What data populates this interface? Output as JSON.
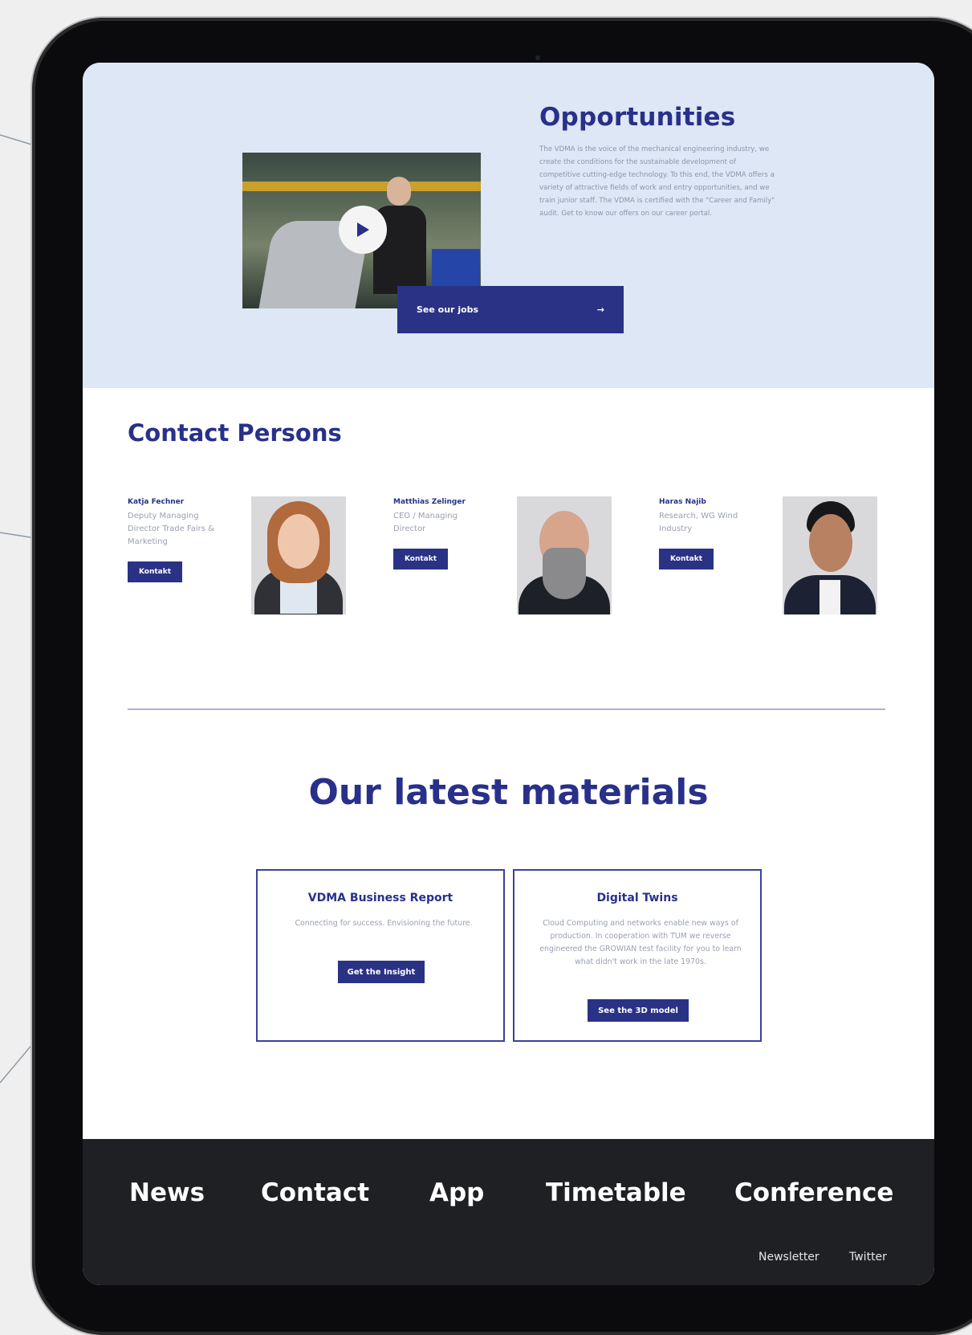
{
  "opportunities": {
    "title": "Opportunities",
    "description": "The VDMA is the voice of the mechanical engineering industry, we create the conditions for the sustainable development of competitive cutting-edge technology. To this end, the VDMA offers a variety of attractive fields of work and entry opportunities, and we train junior staff. The VDMA is certified with the \"Career and Family\" audit. Get to know our offers on our career portal.",
    "jobs_button": "See our jobs",
    "jobs_arrow": "→",
    "video_icon": "play-icon"
  },
  "contacts": {
    "title": "Contact Persons",
    "people": [
      {
        "name": "Katja Fechner",
        "role": "Deputy Managing Director Trade Fairs & Marketing",
        "button": "Kontakt"
      },
      {
        "name": "Matthias Zelinger",
        "role": "CEO / Managing Director",
        "button": "Kontakt"
      },
      {
        "name": "Haras Najib",
        "role": "Research, WG Wind Industry",
        "button": "Kontakt"
      }
    ]
  },
  "materials": {
    "title": "Our latest materials",
    "cards": [
      {
        "title": "VDMA Business Report",
        "description": "Connecting for success. Envisioning the future.",
        "button": "Get the Insight"
      },
      {
        "title": "Digital Twins",
        "description": "Cloud Computing and networks enable new ways of production. In cooperation with TUM we reverse engineered the GROWIAN test facility for you to learn what didn't work in the late 1970s.",
        "button": "See the 3D model"
      }
    ]
  },
  "footer": {
    "nav": [
      "News",
      "Contact",
      "App",
      "Timetable",
      "Conference"
    ],
    "links": [
      "Newsletter",
      "Twitter"
    ]
  },
  "colors": {
    "brand_navy": "#28308a",
    "button_navy": "#2a3286",
    "section_bg": "#dde7f5",
    "footer_bg": "#1f2023"
  }
}
